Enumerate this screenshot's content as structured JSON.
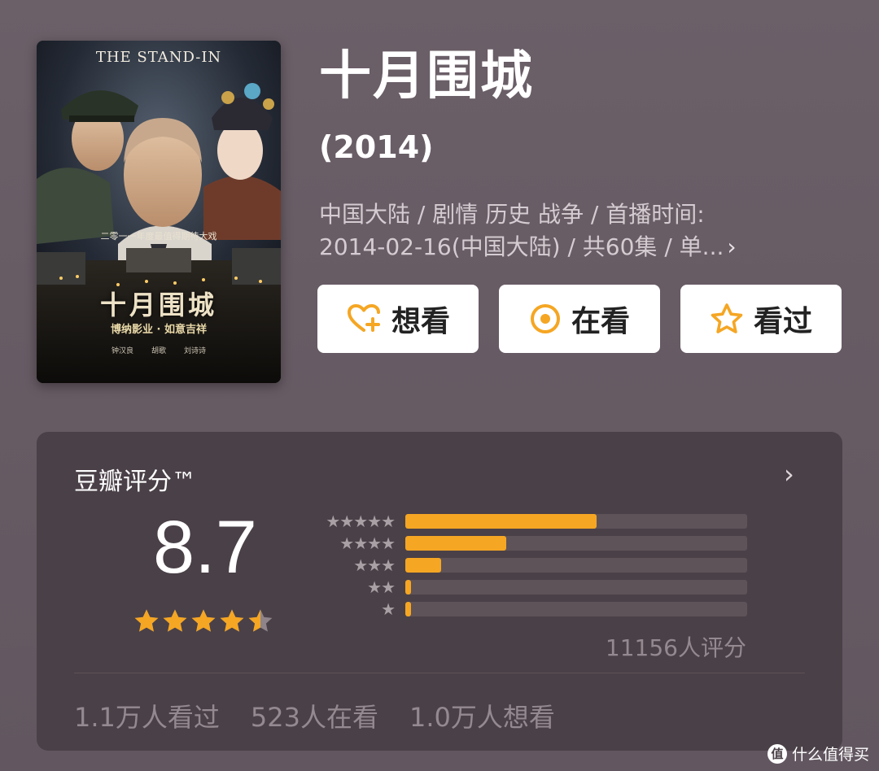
{
  "poster": {
    "en_title": "THE STAND-IN",
    "tagline": "二零一一年度最值得期待大戏",
    "cn_title": "十月围城",
    "studio": "博纳影业 · 如意吉祥",
    "credits": [
      "钟汉良",
      "胡歌",
      "刘诗诗"
    ]
  },
  "title": "十月围城",
  "year": "(2014)",
  "meta": {
    "line1": "中国大陆 / 剧情 历史 战争 / 首播时间:",
    "line2": "2014-02-16(中国大陆) / 共60集 / 单...",
    "chevron": "›"
  },
  "actions": {
    "want_label": "想看",
    "watching_label": "在看",
    "watched_label": "看过"
  },
  "rating": {
    "label": "豆瓣评分™",
    "chevron": "›",
    "score": "8.7",
    "stars_value": 4.5,
    "distribution": [
      {
        "stars": "★★★★★",
        "fraction": 0.56
      },
      {
        "stars": "★★★★",
        "fraction": 0.295
      },
      {
        "stars": "★★★",
        "fraction": 0.105
      },
      {
        "stars": "★★",
        "fraction": 0.015
      },
      {
        "stars": "★",
        "fraction": 0.015
      }
    ],
    "count_label": "11156人评分"
  },
  "stats": {
    "watched": "1.1万人看过",
    "watching": "523人在看",
    "want": "1.0万人想看"
  },
  "watermark": {
    "icon": "值",
    "text": "什么值得买"
  },
  "colors": {
    "accent": "#f5a623",
    "background": "#675b64",
    "card": "#4a4047"
  }
}
